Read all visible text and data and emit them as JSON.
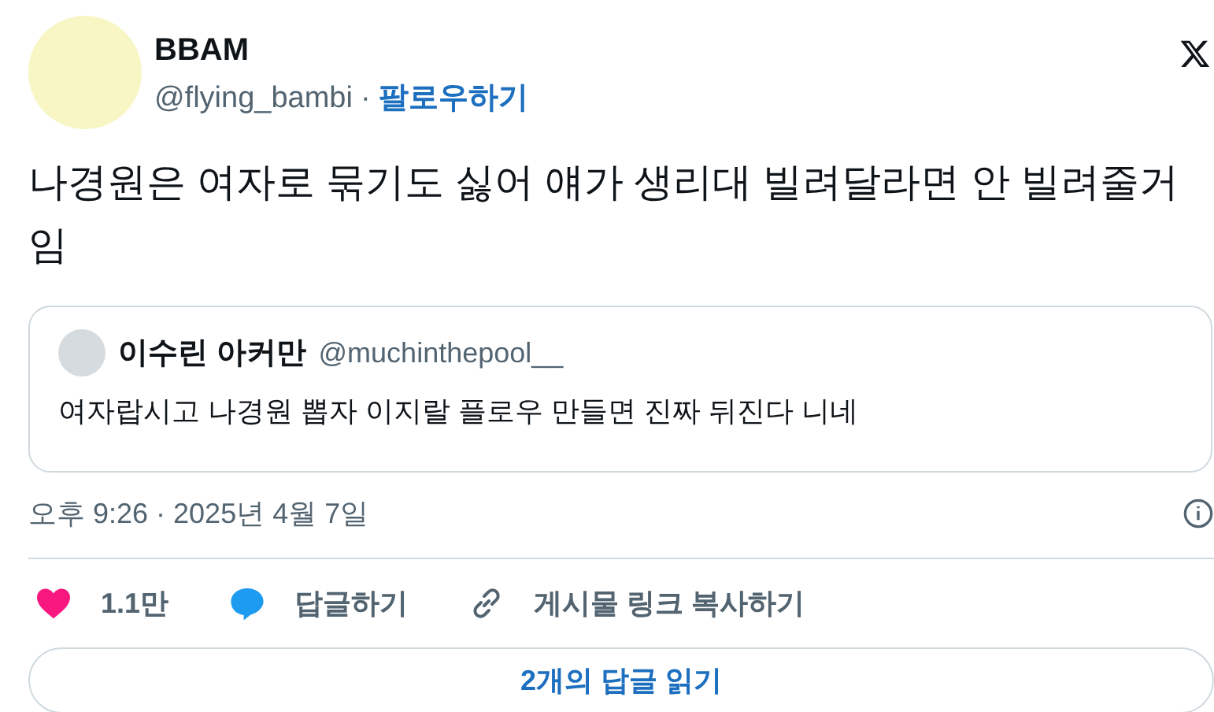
{
  "author": {
    "name": "BBAM",
    "handle": "@flying_bambi",
    "separator": "·",
    "follow": "팔로우하기"
  },
  "text": "나경원은 여자로 묶기도 싫어 얘가 생리대 빌려달라면 안 빌려줄거임",
  "quote": {
    "name": "이수린 아커만",
    "handle": "@muchinthepool__",
    "text": "여자랍시고 나경원 뽑자 이지랄 플로우 만들면 진짜 뒤진다 니네"
  },
  "timestamp": "오후 9:26 · 2025년 4월 7일",
  "actions": [
    {
      "kind": "like",
      "label": "1.1만"
    },
    {
      "kind": "reply",
      "label": "답글하기"
    },
    {
      "kind": "link",
      "label": "게시물 링크 복사하기"
    }
  ],
  "read_replies": "2개의 답글 읽기"
}
